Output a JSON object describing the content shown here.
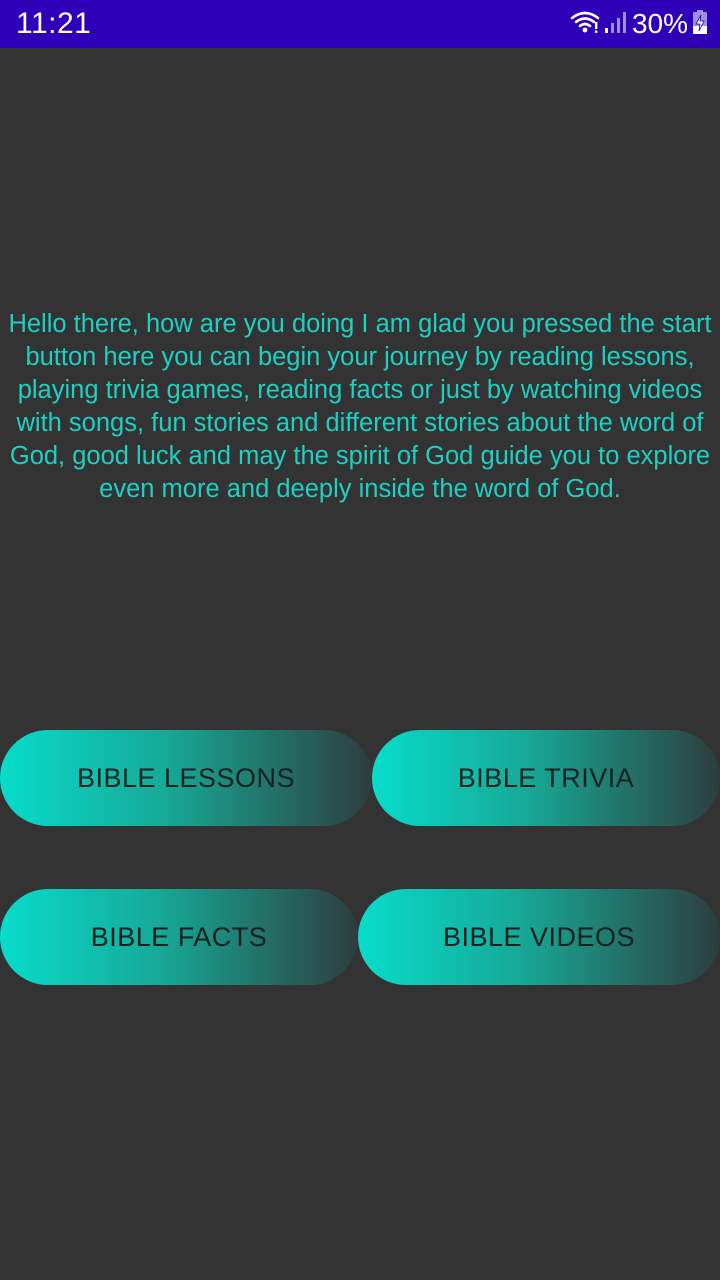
{
  "status_bar": {
    "time": "11:21",
    "battery": "30%",
    "icons": [
      "wifi-icon",
      "signal-icon",
      "battery-charging-icon"
    ],
    "background": "#2E00B8"
  },
  "intro": {
    "text": "Hello there, how are you doing I am glad you pressed the start button here you can begin your journey by reading lessons, playing trivia games, reading facts or just by watching videos with songs, fun stories and different stories about the word of God, good luck and may the spirit of God guide you to explore even more and deeply inside the word of God.",
    "color": "#1ED0C4"
  },
  "buttons": {
    "lessons": "BIBLE LESSONS",
    "trivia": "BIBLE TRIVIA",
    "facts": "BIBLE FACTS",
    "videos": "BIBLE VIDEOS",
    "gradient_start": "#08DCCB",
    "gradient_end": "#2D3E3E"
  },
  "theme": {
    "background": "#333333"
  }
}
